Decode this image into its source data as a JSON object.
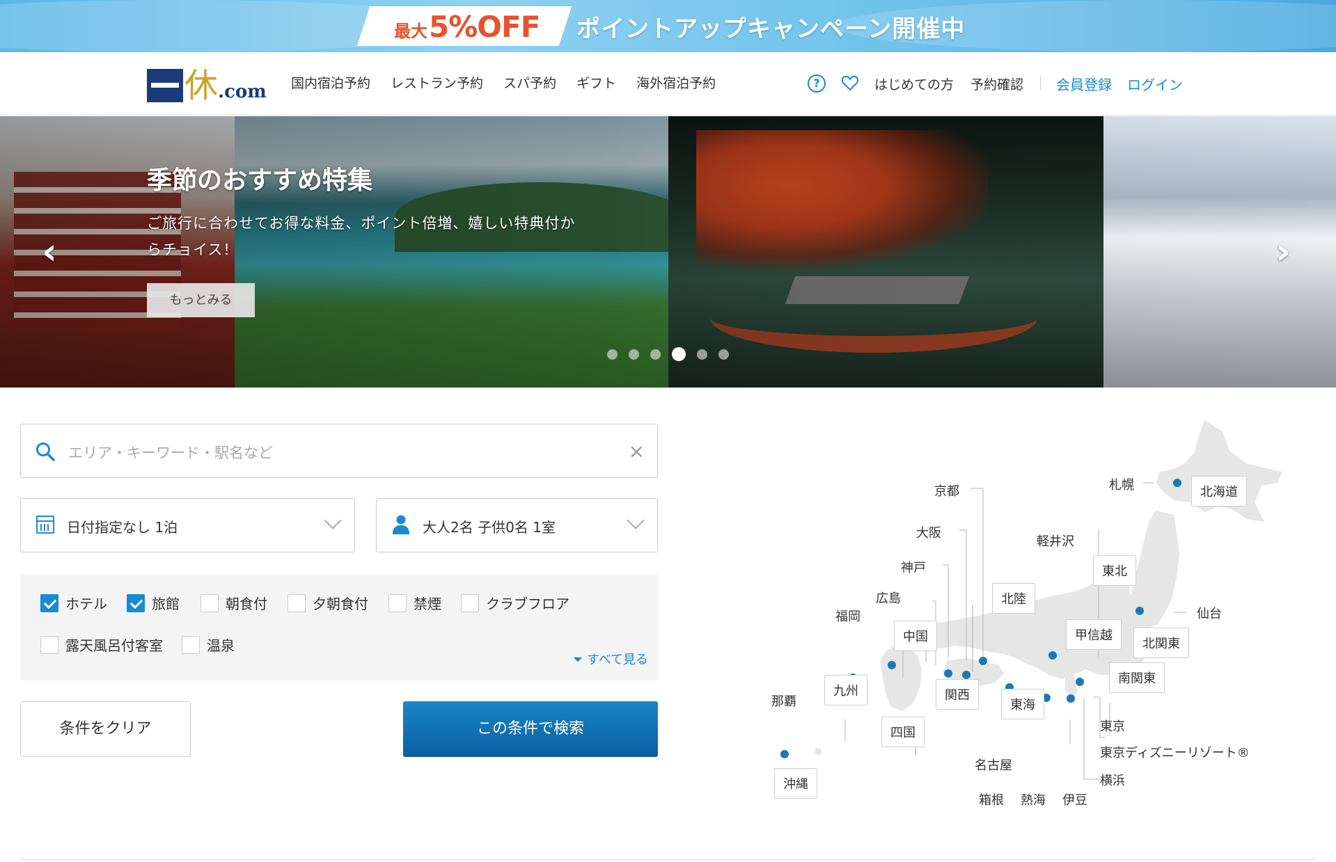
{
  "promo": {
    "badge_prefix": "最大",
    "badge_value": "5%OFF",
    "headline": "ポイントアップキャンペーン開催中"
  },
  "header": {
    "logo_kanji": "一休",
    "logo_suffix": ".com",
    "nav": [
      "国内宿泊予約",
      "レストラン予約",
      "スパ予約",
      "ギフト",
      "海外宿泊予約"
    ],
    "first_time": "はじめての方",
    "reservation_check": "予約確認",
    "register": "会員登録",
    "login": "ログイン"
  },
  "hero": {
    "title": "季節のおすすめ特集",
    "text": "ご旅行に合わせてお得な料金、ポイント倍増、嬉しい特典付からチョイス！",
    "more_button": "もっとみる",
    "prev_arrow": "‹",
    "next_arrow": "›",
    "slide_count": 6,
    "active_slide": 4
  },
  "search": {
    "placeholder": "エリア・キーワード・駅名など",
    "clear_icon": "×",
    "date": "日付指定なし 1泊",
    "guests": "大人2名  子供0名  1室"
  },
  "filters": {
    "options": [
      {
        "label": "ホテル",
        "checked": true
      },
      {
        "label": "旅館",
        "checked": true
      },
      {
        "label": "朝食付",
        "checked": false
      },
      {
        "label": "夕朝食付",
        "checked": false
      },
      {
        "label": "禁煙",
        "checked": false
      },
      {
        "label": "クラブフロア",
        "checked": false
      },
      {
        "label": "露天風呂付客室",
        "checked": false
      },
      {
        "label": "温泉",
        "checked": false
      }
    ],
    "see_all": "すべて見る"
  },
  "buttons": {
    "clear": "条件をクリア",
    "search": "この条件で検索"
  },
  "map": {
    "cities": {
      "sapporo": "札幌",
      "kyoto": "京都",
      "osaka": "大阪",
      "kobe": "神戸",
      "hiroshima": "広島",
      "fukuoka": "福岡",
      "karuizawa": "軽井沢",
      "sendai": "仙台",
      "naha": "那覇",
      "nagoya": "名古屋",
      "tokyo": "東京",
      "disney": "東京ディズニーリゾート®",
      "yokohama": "横浜",
      "hakone": "箱根",
      "atami": "熱海",
      "izu": "伊豆"
    },
    "regions": {
      "hokkaido": "北海道",
      "tohoku": "東北",
      "hokuriku": "北陸",
      "koshinetsu": "甲信越",
      "kitakanto": "北関東",
      "minamikanto": "南関東",
      "chugoku": "中国",
      "kansai": "関西",
      "tokai": "東海",
      "kyushu": "九州",
      "shikoku": "四国",
      "okinawa": "沖縄"
    }
  },
  "colors": {
    "accent": "#1a8ad4",
    "search_button": "#0a5fa0",
    "promo_badge": "#e8522c",
    "logo_navy": "#1c3a7a",
    "logo_gold": "#c9a52a"
  }
}
